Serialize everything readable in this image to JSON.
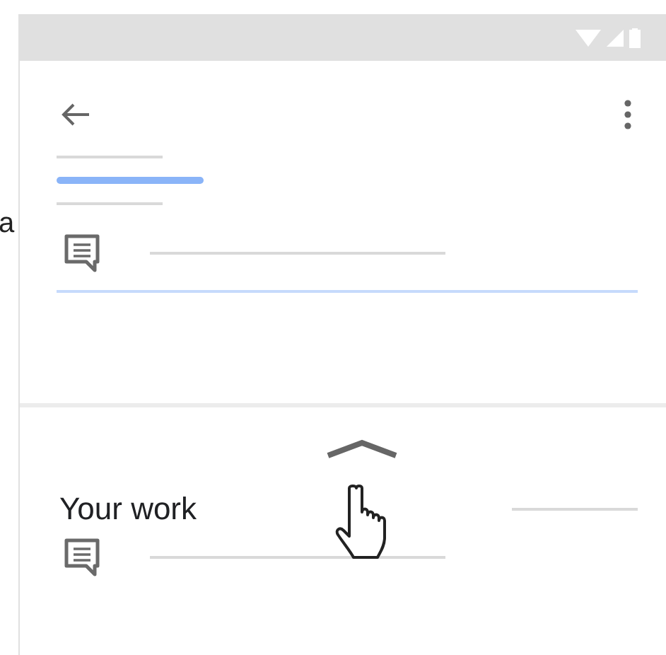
{
  "edge_text": "a",
  "bottom_sheet": {
    "title": "Your work"
  }
}
